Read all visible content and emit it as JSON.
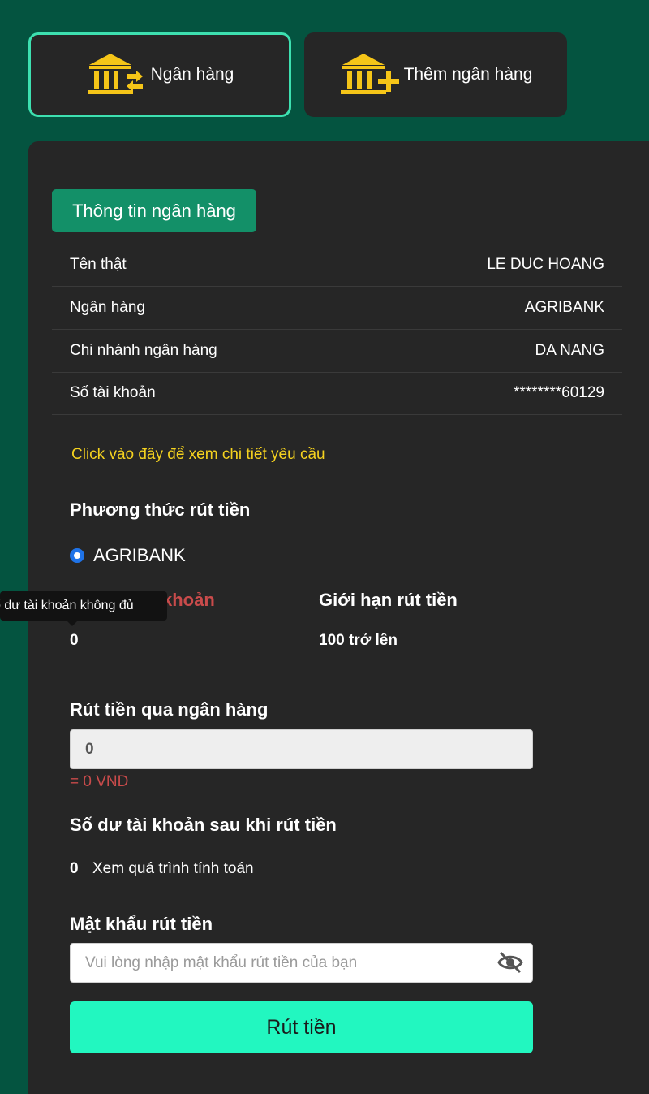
{
  "tabs": [
    {
      "label": "Ngân hàng",
      "icon": "bank-transfer-icon",
      "active": true
    },
    {
      "label": "Thêm ngân hàng",
      "icon": "bank-add-icon",
      "active": false
    }
  ],
  "bank_info": {
    "title": "Thông tin ngân hàng",
    "rows": [
      {
        "label": "Tên thật",
        "value": "LE DUC HOANG"
      },
      {
        "label": "Ngân hàng",
        "value": "AGRIBANK"
      },
      {
        "label": "Chi nhánh ngân hàng",
        "value": "DA NANG"
      },
      {
        "label": "Số tài khoản",
        "value": "********60129"
      }
    ],
    "details_link": "Click vào đây để xem chi tiết yêu cầu"
  },
  "withdraw_method": {
    "title": "Phương thức rút tiền",
    "selected_option": "AGRIBANK"
  },
  "balance": {
    "label_visible": "khoản",
    "value": "0",
    "tooltip": "ố dư tài khoản không đủ"
  },
  "limit": {
    "label": "Giới hạn rút tiền",
    "value": "100 trở lên"
  },
  "withdraw_bank": {
    "title": "Rút tiền qua ngân hàng",
    "amount_value": "0",
    "converted": "= 0 VND"
  },
  "after_balance": {
    "title": "Số dư tài khoản sau khi rút tiền",
    "value": "0",
    "calc_link": "Xem quá trình tính toán"
  },
  "password": {
    "title": "Mật khẩu rút tiền",
    "placeholder": "Vui lòng nhập mật khẩu rút tiền của bạn"
  },
  "submit_label": "Rút tiền",
  "colors": {
    "background": "#045440",
    "panel": "#262626",
    "accent": "#22f7c0",
    "badge": "#139068",
    "gold": "#f5c518",
    "warning_red": "#c94b4b",
    "link_yellow": "#f5d21f"
  }
}
